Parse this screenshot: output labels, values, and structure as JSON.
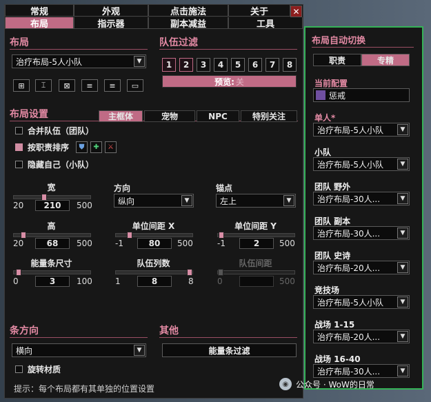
{
  "main_tabs": [
    {
      "label": "常规"
    },
    {
      "label": "外观"
    },
    {
      "label": "点击施法"
    },
    {
      "label": "关于"
    },
    {
      "label": "布局"
    },
    {
      "label": "指示器"
    },
    {
      "label": "副本减益"
    },
    {
      "label": "工具"
    }
  ],
  "close_label": "✕",
  "layout": {
    "title": "布局",
    "selected": "治疗布局-5人小队",
    "icons": [
      "new-layout-icon",
      "rename-icon",
      "delete-icon",
      "import-icon",
      "export-icon",
      "share-icon"
    ]
  },
  "group_filter": {
    "title": "队伍过滤",
    "groups": [
      "1",
      "2",
      "3",
      "4",
      "5",
      "6",
      "7",
      "8"
    ],
    "selected": [
      "1",
      "2"
    ],
    "preview_label": "预览:",
    "preview_state": "关"
  },
  "layout_settings": {
    "title": "布局设置",
    "tabs": [
      "主框体",
      "宠物",
      "NPC",
      "特别关注"
    ],
    "active_tab": "主框体",
    "merge_groups": {
      "label": "合并队伍（团队）",
      "checked": false
    },
    "sort_by_role": {
      "label": "按职责排序",
      "checked": true
    },
    "role_icons": [
      "tank-role-icon",
      "healer-role-icon",
      "dps-role-icon"
    ],
    "hide_self": {
      "label": "隐藏自己（小队）",
      "checked": false
    }
  },
  "sliders": {
    "width": {
      "label": "宽",
      "min": "20",
      "value": "210",
      "max": "500",
      "pos": 0.39
    },
    "height": {
      "label": "高",
      "min": "20",
      "value": "68",
      "max": "500",
      "pos": 0.1
    },
    "spacing_x": {
      "label": "单位间距 X",
      "min": "-1",
      "value": "80",
      "max": "500",
      "pos": 0.16
    },
    "spacing_y": {
      "label": "单位间距 Y",
      "min": "-1",
      "value": "2",
      "max": "500",
      "pos": 0.01
    },
    "power_size": {
      "label": "能量条尺寸",
      "min": "0",
      "value": "3",
      "max": "100",
      "pos": 0.03
    },
    "group_columns": {
      "label": "队伍列数",
      "min": "1",
      "value": "8",
      "max": "8",
      "pos": 1.0
    },
    "group_spacing": {
      "label": "队伍间距",
      "min": "0",
      "value": "",
      "max": "500",
      "pos": 0.0,
      "disabled": true
    }
  },
  "orientation": {
    "label": "方向",
    "value": "纵向"
  },
  "anchor": {
    "label": "锚点",
    "value": "左上"
  },
  "bar_orientation": {
    "title": "条方向",
    "value": "横向",
    "rotate_texture": {
      "label": "旋转材质",
      "checked": false
    }
  },
  "other": {
    "title": "其他",
    "power_filter_label": "能量条过滤"
  },
  "hint": "提示：每个布局都有其单独的位置设置",
  "auto_switch": {
    "title": "布局自动切换",
    "toggle": [
      "职责",
      "专精"
    ],
    "active_toggle": "专精",
    "current_config_label": "当前配置",
    "current_spec": "惩戒",
    "rows": [
      {
        "label": "单人*",
        "value": "治疗布局-5人小队",
        "highlight": true
      },
      {
        "label": "小队",
        "value": "治疗布局-5人小队"
      },
      {
        "label": "团队 野外",
        "value": "治疗布局-30人..."
      },
      {
        "label": "团队 副本",
        "value": "治疗布局-30人..."
      },
      {
        "label": "团队 史诗",
        "value": "治疗布局-20人..."
      },
      {
        "label": "竞技场",
        "value": "治疗布局-5人小队"
      },
      {
        "label": "战场 1-15",
        "value": "治疗布局-20人..."
      },
      {
        "label": "战场 16-40",
        "value": "治疗布局-30人..."
      }
    ]
  },
  "watermark": "公众号 · WoW的日常",
  "colors": {
    "accent": "#c06b85",
    "accent_text": "#e38aa4",
    "highlight_border": "#35b257",
    "close": "#8c1e1e"
  }
}
